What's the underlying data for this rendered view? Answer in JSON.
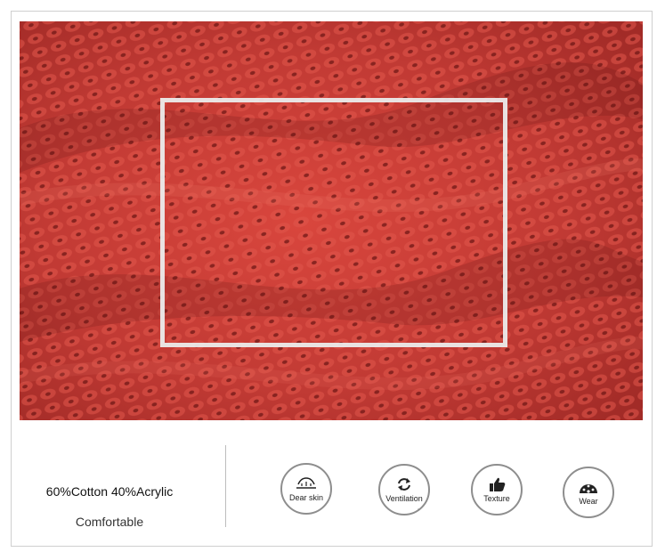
{
  "details": {
    "material": "60%Cotton 40%Acrylic",
    "feel": "Comfortable"
  },
  "features": [
    {
      "label": "Dear skin",
      "icon": "skin-icon"
    },
    {
      "label": "Ventilation",
      "icon": "refresh-arrows-icon"
    },
    {
      "label": "Texture",
      "icon": "thumbs-up-icon"
    },
    {
      "label": "Wear",
      "icon": "speedometer-icon"
    }
  ],
  "ventilation_mark": ",",
  "colors": {
    "knit": "#c13a34",
    "knit_shadow": "#7f1e1c",
    "badge_border": "#8e8e8e"
  }
}
